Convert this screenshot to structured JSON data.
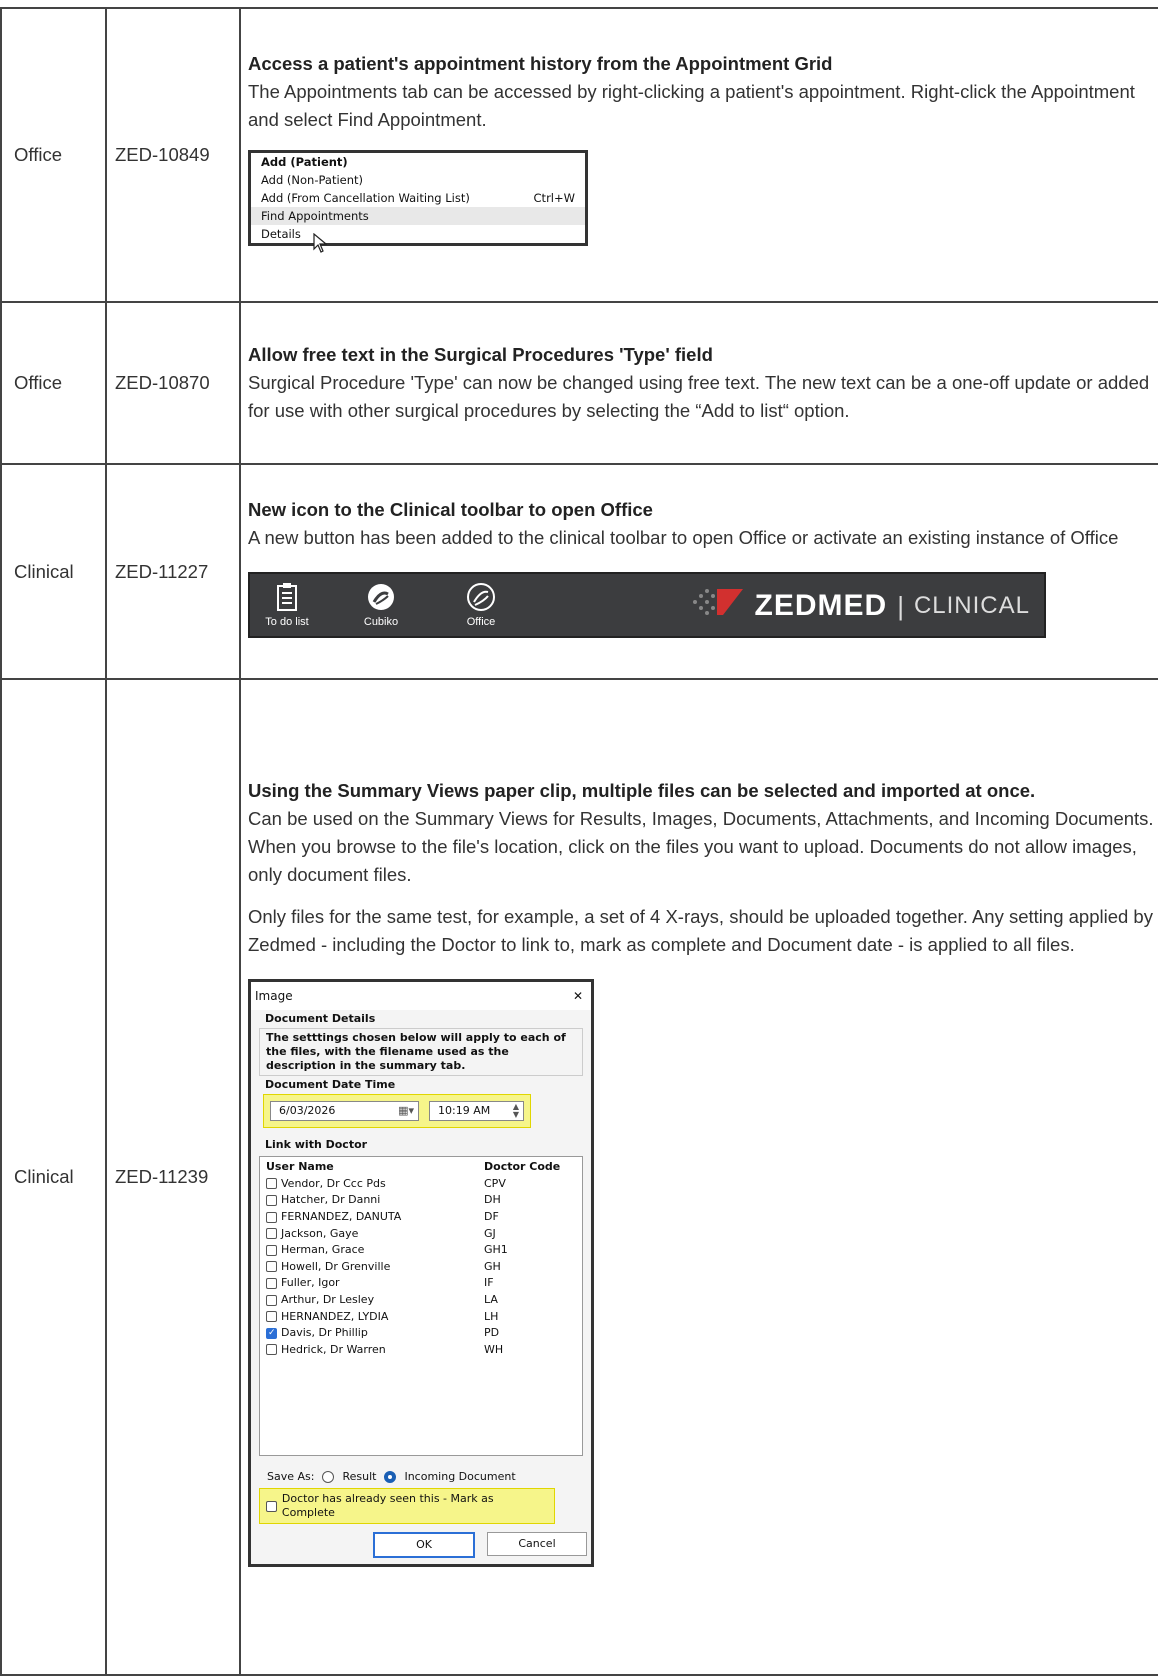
{
  "rows": [
    {
      "area": "Office",
      "code": "ZED-10849",
      "title": "Access a patient's appointment history from the Appointment Grid",
      "text": "The Appointments tab can be accessed by right-clicking a patient's appointment. Right-click the Appointment and select Find Appointment.",
      "menu": {
        "items": [
          {
            "label": "Add (Patient)",
            "shortcut": ""
          },
          {
            "label": "Add (Non-Patient)",
            "shortcut": ""
          },
          {
            "label": "Add (From Cancellation Waiting List)",
            "shortcut": "Ctrl+W"
          },
          {
            "label": "Find Appointments",
            "shortcut": ""
          },
          {
            "label": "Details",
            "shortcut": ""
          }
        ]
      }
    },
    {
      "area": "Office",
      "code": "ZED-10870",
      "title": "Allow free text in the Surgical Procedures 'Type' field",
      "text": "Surgical Procedure 'Type' can now be changed using free text. The new text can be a one-off update or added for use with other surgical procedures by selecting the “Add to list“ option."
    },
    {
      "area": "Clinical",
      "code": "ZED-11227",
      "title": "New icon to the Clinical toolbar to open Office",
      "text": "A new button has been added to the clinical toolbar to open Office or activate an existing instance of Office",
      "toolbar": {
        "buttons": [
          {
            "label": "To do list",
            "icon": "clipboard-list-icon"
          },
          {
            "label": "Cubiko",
            "icon": "cubiko-icon"
          },
          {
            "label": "Office",
            "icon": "office-icon"
          }
        ],
        "brand": "ZEDMED",
        "brand_sep": "|",
        "brand_sub": "CLINICAL"
      }
    },
    {
      "area": "Clinical",
      "code": "ZED-11239",
      "title": "Using the  Summary Views paper clip, multiple files can be selected and imported at once.",
      "text": "Can be used on the Summary Views for Results, Images, Documents, Attachments, and Incoming Documents. When you browse to the file's location, click on the files you want to upload. Documents do not allow images, only document files.",
      "text2": "Only files for the same test, for example, a set of 4 X-rays, should be uploaded together. Any setting applied by Zedmed - including the Doctor to link to, mark as complete and Document date - is applied to all files.",
      "dialog": {
        "title": "Image",
        "close": "✕",
        "doc_details_label": "Document Details",
        "doc_details_text": "The setttings chosen below will apply to each of the files, with the filename used as the description in the summary tab.",
        "date_label": "Document Date Time",
        "date_value": "6/03/2026",
        "time_value": "10:19 AM",
        "link_label": "Link with Doctor",
        "col_user": "User Name",
        "col_code": "Doctor Code",
        "doctors": [
          {
            "name": "Vendor, Dr Ccc Pds",
            "code": "CPV",
            "checked": false
          },
          {
            "name": "Hatcher, Dr Danni",
            "code": "DH",
            "checked": false
          },
          {
            "name": "FERNANDEZ,  DANUTA",
            "code": "DF",
            "checked": false
          },
          {
            "name": "Jackson,  Gaye",
            "code": "GJ",
            "checked": false
          },
          {
            "name": "Herman,  Grace",
            "code": "GH1",
            "checked": false
          },
          {
            "name": "Howell, Dr Grenville",
            "code": "GH",
            "checked": false
          },
          {
            "name": "Fuller,  Igor",
            "code": "IF",
            "checked": false
          },
          {
            "name": "Arthur, Dr Lesley",
            "code": "LA",
            "checked": false
          },
          {
            "name": "HERNANDEZ,  LYDIA",
            "code": "LH",
            "checked": false
          },
          {
            "name": "Davis, Dr Phillip",
            "code": "PD",
            "checked": true
          },
          {
            "name": "Hedrick, Dr Warren",
            "code": "WH",
            "checked": false
          }
        ],
        "save_as_label": "Save As:",
        "opt_result": "Result",
        "opt_incoming": "Incoming Document",
        "selected_option": "Incoming Document",
        "seen_label": "Doctor has already seen this - Mark as Complete",
        "ok_label": "OK",
        "cancel_label": "Cancel"
      }
    }
  ]
}
